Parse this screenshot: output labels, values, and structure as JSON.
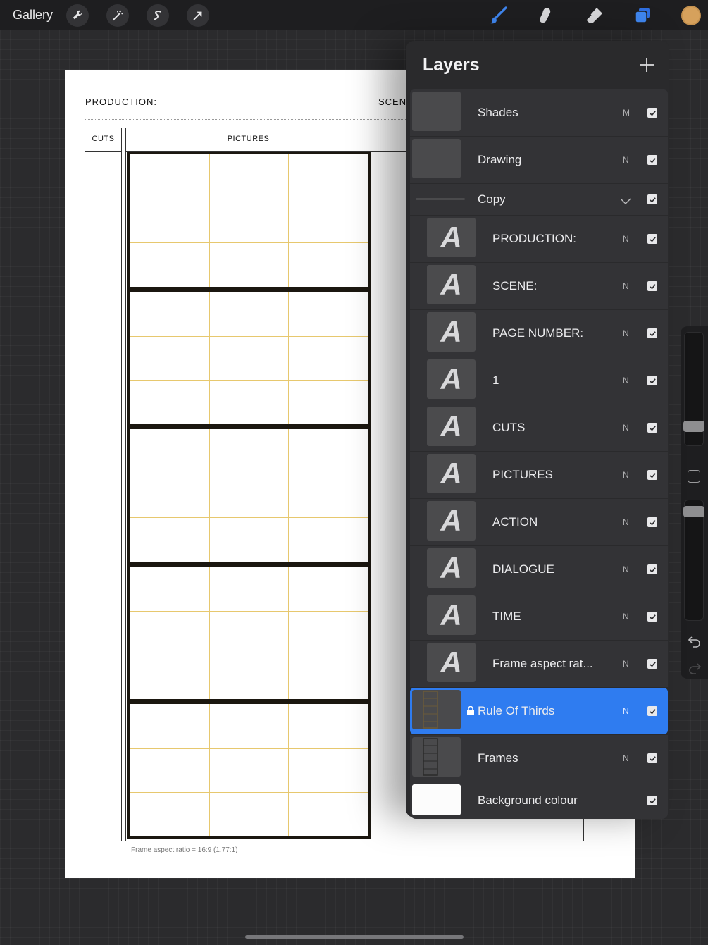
{
  "toolbar": {
    "gallery_label": "Gallery",
    "left_icons": [
      "wrench-icon",
      "magic-wand-icon",
      "selection-icon",
      "transform-arrow-icon"
    ],
    "right_tools": [
      "brush-icon",
      "smudge-icon",
      "eraser-icon",
      "layers-icon"
    ],
    "active_color": "#d6a15c",
    "accent_color": "#2f7cf0"
  },
  "document": {
    "production_label": "PRODUCTION:",
    "scene_label": "SCENE",
    "cuts_header": "CUTS",
    "pictures_header": "PICTURES",
    "caption": "Frame aspect ratio = 16:9 (1.77:1)",
    "frame_count": 5
  },
  "layers_panel": {
    "title": "Layers",
    "add_icon": "plus-icon",
    "layers": [
      {
        "name": "Shades",
        "mode": "M",
        "visible": true,
        "type": "image"
      },
      {
        "name": "Drawing",
        "mode": "N",
        "visible": true,
        "type": "image"
      },
      {
        "name": "Copy",
        "mode": "",
        "visible": true,
        "type": "group"
      },
      {
        "name": "PRODUCTION:",
        "mode": "N",
        "visible": true,
        "type": "text"
      },
      {
        "name": "SCENE:",
        "mode": "N",
        "visible": true,
        "type": "text"
      },
      {
        "name": "PAGE NUMBER:",
        "mode": "N",
        "visible": true,
        "type": "text"
      },
      {
        "name": "1",
        "mode": "N",
        "visible": true,
        "type": "text"
      },
      {
        "name": "CUTS",
        "mode": "N",
        "visible": true,
        "type": "text"
      },
      {
        "name": "PICTURES",
        "mode": "N",
        "visible": true,
        "type": "text"
      },
      {
        "name": "ACTION",
        "mode": "N",
        "visible": true,
        "type": "text"
      },
      {
        "name": "DIALOGUE",
        "mode": "N",
        "visible": true,
        "type": "text"
      },
      {
        "name": "TIME",
        "mode": "N",
        "visible": true,
        "type": "text"
      },
      {
        "name": "Frame aspect rat...",
        "mode": "N",
        "visible": true,
        "type": "text"
      },
      {
        "name": "Rule Of Thirds",
        "mode": "N",
        "visible": true,
        "type": "image",
        "selected": true,
        "locked": true
      },
      {
        "name": "Frames",
        "mode": "N",
        "visible": true,
        "type": "image"
      },
      {
        "name": "Background colour",
        "mode": "",
        "visible": true,
        "type": "background"
      }
    ]
  }
}
